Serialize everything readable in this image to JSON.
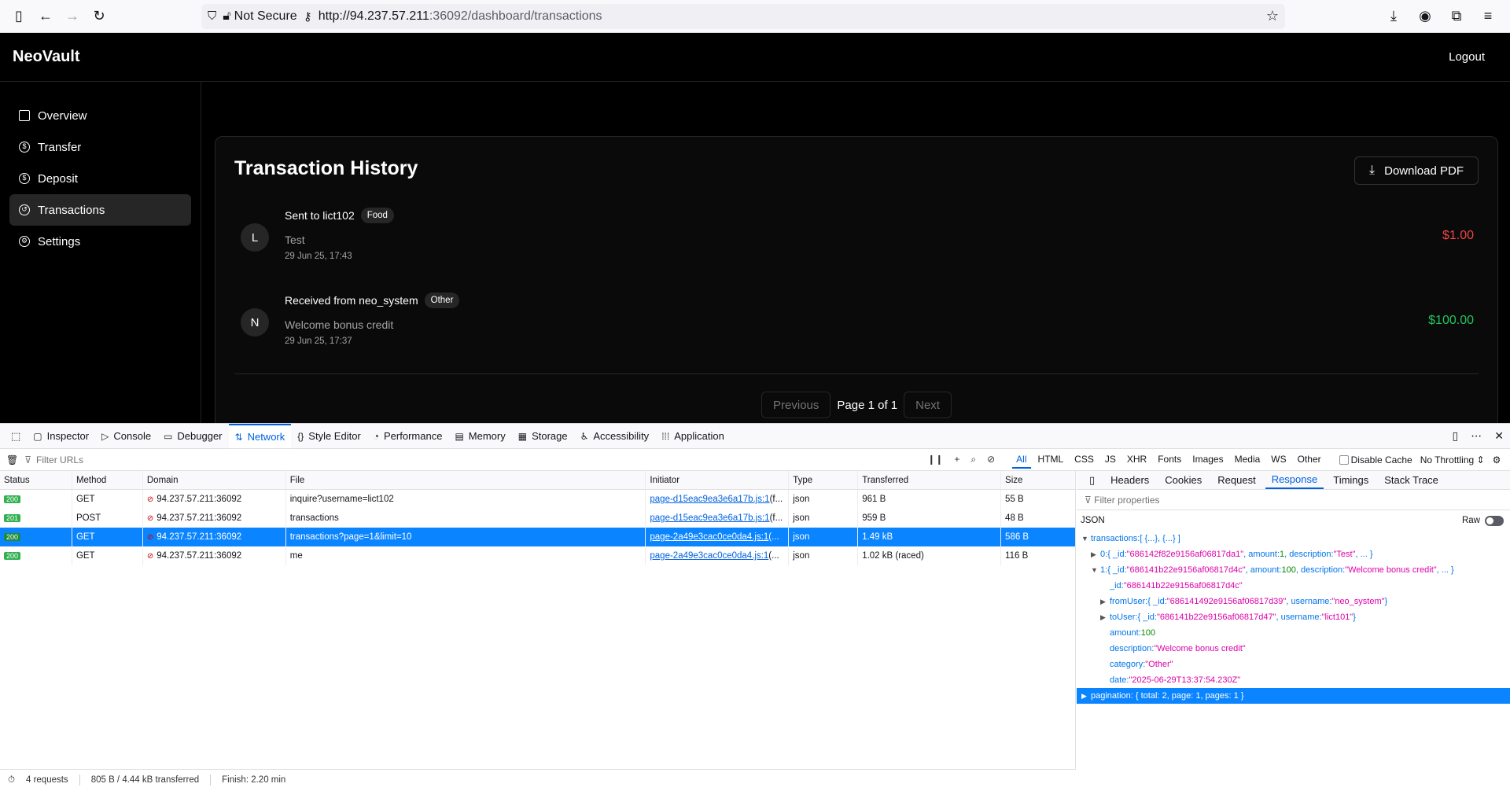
{
  "browser": {
    "security_label": "Not Secure",
    "url_host": "http://94.237.57.211",
    "url_rest": ":36092/dashboard/transactions"
  },
  "app": {
    "brand": "NeoVault",
    "logout": "Logout",
    "nav": [
      {
        "label": "Overview",
        "icon": "grid-icon"
      },
      {
        "label": "Transfer",
        "icon": "dollar-icon"
      },
      {
        "label": "Deposit",
        "icon": "dollar-icon"
      },
      {
        "label": "Transactions",
        "icon": "history-icon"
      },
      {
        "label": "Settings",
        "icon": "gear-icon"
      }
    ],
    "page_title": "Transaction History",
    "download_pdf": "Download PDF",
    "transactions": [
      {
        "avatar": "L",
        "title": "Sent to lict102",
        "tag": "Food",
        "description": "Test",
        "date": "29 Jun 25, 17:43",
        "amount": "$1.00"
      },
      {
        "avatar": "N",
        "title": "Received from neo_system",
        "tag": "Other",
        "description": "Welcome bonus credit",
        "date": "29 Jun 25, 17:37",
        "amount": "$100.00"
      }
    ],
    "pager": {
      "previous": "Previous",
      "info": "Page 1 of 1",
      "next": "Next"
    }
  },
  "devtools": {
    "tabs": [
      "Inspector",
      "Console",
      "Debugger",
      "Network",
      "Style Editor",
      "Performance",
      "Memory",
      "Storage",
      "Accessibility",
      "Application"
    ],
    "filter_placeholder": "Filter URLs",
    "type_filters": [
      "All",
      "HTML",
      "CSS",
      "JS",
      "XHR",
      "Fonts",
      "Images",
      "Media",
      "WS",
      "Other"
    ],
    "disable_cache": "Disable Cache",
    "throttling": "No Throttling",
    "columns": [
      "Status",
      "Method",
      "Domain",
      "File",
      "Initiator",
      "Type",
      "Transferred",
      "Size"
    ],
    "requests": [
      {
        "status": "200",
        "method": "GET",
        "domain": "94.237.57.211:36092",
        "file": "inquire?username=lict102",
        "initiator": "page-d15eac9ea3e6a17b.js:1",
        "initiator_suffix": " (f...",
        "type": "json",
        "transferred": "961 B",
        "size": "55 B"
      },
      {
        "status": "201",
        "method": "POST",
        "domain": "94.237.57.211:36092",
        "file": "transactions",
        "initiator": "page-d15eac9ea3e6a17b.js:1",
        "initiator_suffix": " (f...",
        "type": "json",
        "transferred": "959 B",
        "size": "48 B"
      },
      {
        "status": "200",
        "method": "GET",
        "domain": "94.237.57.211:36092",
        "file": "transactions?page=1&limit=10",
        "initiator": "page-2a49e3cac0ce0da4.js:1",
        "initiator_suffix": " (...",
        "type": "json",
        "transferred": "1.49 kB",
        "size": "586 B"
      },
      {
        "status": "200",
        "method": "GET",
        "domain": "94.237.57.211:36092",
        "file": "me",
        "initiator": "page-2a49e3cac0ce0da4.js:1",
        "initiator_suffix": " (...",
        "type": "json",
        "transferred": "1.02 kB (raced)",
        "size": "116 B"
      }
    ],
    "summary": {
      "requests": "4 requests",
      "transferred": "805 B / 4.44 kB transferred",
      "finish": "Finish: 2.20 min"
    },
    "panel_tabs": [
      "Headers",
      "Cookies",
      "Request",
      "Response",
      "Timings",
      "Stack Trace"
    ],
    "panel_filter": "Filter properties",
    "json_label": "JSON",
    "raw_label": "Raw",
    "tree": {
      "transactions": "transactions: ",
      "transactions_preview": "[ {...}, {...} ]",
      "item0_key": "0: ",
      "item0_preview_a": "{ _id: ",
      "item0_id": "\"686142f82e9156af06817da1\"",
      "item0_preview_b": ", amount: ",
      "item0_amount": "1",
      "item0_preview_c": ", description: ",
      "item0_desc": "\"Test\"",
      "item0_preview_d": ", ... }",
      "item1_key": "1: ",
      "item1_preview_a": "{ _id: ",
      "item1_id": "\"686141b22e9156af06817d4c\"",
      "item1_preview_b": ", amount: ",
      "item1_amount": "100",
      "item1_preview_c": ", description: ",
      "item1_desc": "\"Welcome bonus credit\"",
      "item1_preview_d": ", ... }",
      "id_key": "_id: ",
      "id_val": "\"686141b22e9156af06817d4c\"",
      "from_key": "fromUser: ",
      "from_a": "{ _id: ",
      "from_id": "\"686141492e9156af06817d39\"",
      "from_b": ", username: ",
      "from_user": "\"neo_system\"",
      "from_c": " }",
      "to_key": "toUser: ",
      "to_a": "{ _id: ",
      "to_id": "\"686141b22e9156af06817d47\"",
      "to_b": ", username: ",
      "to_user": "\"lict101\"",
      "to_c": " }",
      "amount_key": "amount: ",
      "amount_val": "100",
      "desc_key": "description: ",
      "desc_val": "\"Welcome bonus credit\"",
      "cat_key": "category: ",
      "cat_val": "\"Other\"",
      "date_key": "date: ",
      "date_val": "\"2025-06-29T13:37:54.230Z\"",
      "pagination": "pagination: { total: 2, page: 1, pages: 1 }"
    }
  }
}
